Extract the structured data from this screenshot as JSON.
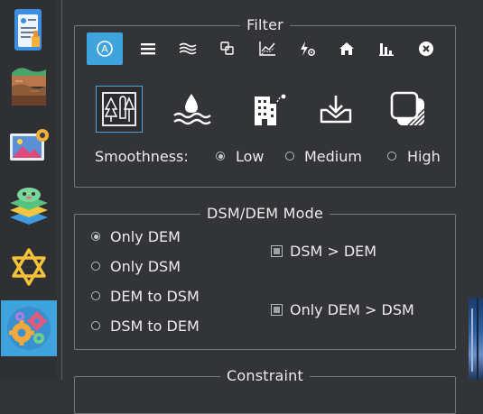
{
  "sidebar": {
    "items": [
      {
        "name": "document-form-icon"
      },
      {
        "name": "terrain-layers-icon"
      },
      {
        "name": "image-settings-icon"
      },
      {
        "name": "stacked-layers-icon"
      },
      {
        "name": "star-of-david-icon"
      },
      {
        "name": "gears-icon",
        "active": true
      }
    ]
  },
  "filter": {
    "title": "Filter",
    "toolbar": [
      "filter-a-icon",
      "menu-lines-icon",
      "waves-icon",
      "copy-shapes-icon",
      "line-chart-icon",
      "thunder-settings-icon",
      "home-icon",
      "bar-chart-icon",
      "close-circle-icon"
    ],
    "big_icons": [
      "forest-icon",
      "water-icon",
      "building-icon",
      "download-terrain-icon",
      "stacked-squares-icon"
    ],
    "smoothness_label": "Smoothness:",
    "smoothness_options": [
      "Low",
      "Medium",
      "High"
    ],
    "smoothness_selected": "Low"
  },
  "dsm_dem": {
    "title": "DSM/DEM Mode",
    "radio_options": [
      "Only DEM",
      "Only DSM",
      "DEM to DSM",
      "DSM to DEM"
    ],
    "radio_selected": "Only DEM",
    "checkboxes": [
      "DSM > DEM",
      "Only DEM > DSM"
    ]
  },
  "constraint": {
    "title": "Constraint"
  },
  "colors": {
    "accent": "#3fa3dd",
    "background": "#323437",
    "border": "#74767b"
  }
}
